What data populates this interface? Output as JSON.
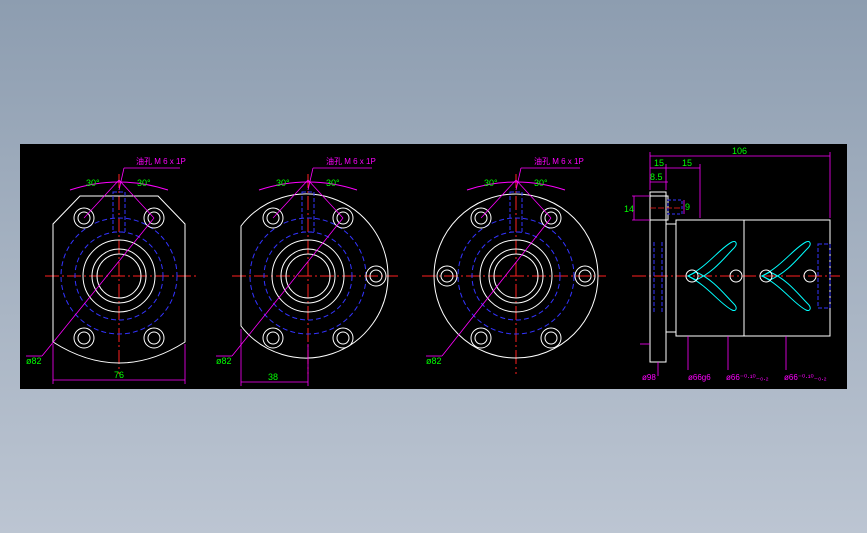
{
  "colors": {
    "background": "#000000",
    "outline": "#ffffff",
    "hidden": "#3333ff",
    "center": "#ff2020",
    "dimension": "#ff00ff",
    "text": "#00ff00",
    "slot": "#00ffff"
  },
  "views": [
    {
      "type": "square-flange",
      "angle_left": "30°",
      "angle_right": "30°",
      "hole_note": "油孔 M 6 x 1P",
      "diameter": "ø82",
      "width": "76"
    },
    {
      "type": "cut-flange",
      "angle_left": "30°",
      "angle_right": "30°",
      "hole_note": "油孔 M 6 x 1P",
      "diameter": "ø82",
      "offset": "38"
    },
    {
      "type": "round-flange",
      "angle_left": "30°",
      "angle_right": "30°",
      "hole_note": "油孔 M 6 x 1P",
      "diameter": "ø82"
    }
  ],
  "side_view": {
    "length": "106",
    "flange_thickness": "15",
    "shoulder": "15",
    "depth_a": "8.5",
    "depth_b": "14",
    "depth_c": "9",
    "dia_flange": "ø98",
    "dia_fit": "ø66g6",
    "dia_body_a": "ø66⁻⁰·¹⁰₋₀.₂",
    "dia_body_b": "ø66⁻⁰·¹⁰₋₀.₂"
  }
}
